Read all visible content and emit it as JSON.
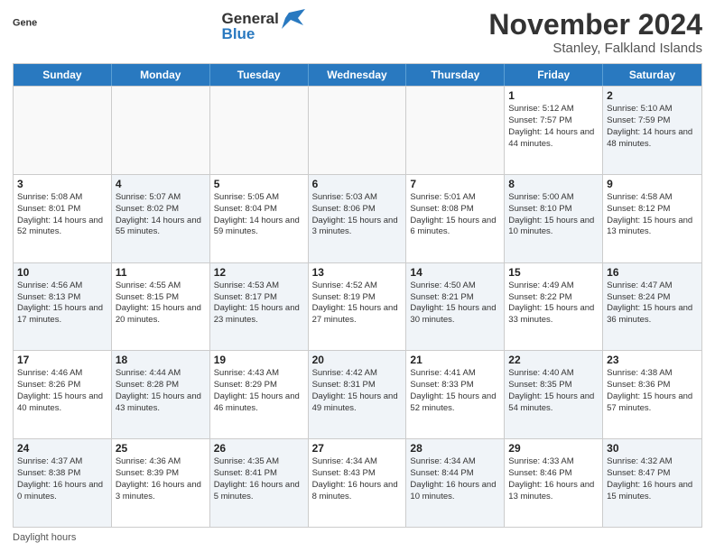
{
  "header": {
    "logo_general": "General",
    "logo_blue": "Blue",
    "month_title": "November 2024",
    "subtitle": "Stanley, Falkland Islands"
  },
  "calendar": {
    "days_of_week": [
      "Sunday",
      "Monday",
      "Tuesday",
      "Wednesday",
      "Thursday",
      "Friday",
      "Saturday"
    ],
    "rows": [
      [
        {
          "day": "",
          "info": "",
          "empty": true
        },
        {
          "day": "",
          "info": "",
          "empty": true
        },
        {
          "day": "",
          "info": "",
          "empty": true
        },
        {
          "day": "",
          "info": "",
          "empty": true
        },
        {
          "day": "",
          "info": "",
          "empty": true
        },
        {
          "day": "1",
          "info": "Sunrise: 5:12 AM\nSunset: 7:57 PM\nDaylight: 14 hours and 44 minutes.",
          "empty": false,
          "alt": false
        },
        {
          "day": "2",
          "info": "Sunrise: 5:10 AM\nSunset: 7:59 PM\nDaylight: 14 hours and 48 minutes.",
          "empty": false,
          "alt": true
        }
      ],
      [
        {
          "day": "3",
          "info": "Sunrise: 5:08 AM\nSunset: 8:01 PM\nDaylight: 14 hours and 52 minutes.",
          "empty": false,
          "alt": false
        },
        {
          "day": "4",
          "info": "Sunrise: 5:07 AM\nSunset: 8:02 PM\nDaylight: 14 hours and 55 minutes.",
          "empty": false,
          "alt": true
        },
        {
          "day": "5",
          "info": "Sunrise: 5:05 AM\nSunset: 8:04 PM\nDaylight: 14 hours and 59 minutes.",
          "empty": false,
          "alt": false
        },
        {
          "day": "6",
          "info": "Sunrise: 5:03 AM\nSunset: 8:06 PM\nDaylight: 15 hours and 3 minutes.",
          "empty": false,
          "alt": true
        },
        {
          "day": "7",
          "info": "Sunrise: 5:01 AM\nSunset: 8:08 PM\nDaylight: 15 hours and 6 minutes.",
          "empty": false,
          "alt": false
        },
        {
          "day": "8",
          "info": "Sunrise: 5:00 AM\nSunset: 8:10 PM\nDaylight: 15 hours and 10 minutes.",
          "empty": false,
          "alt": true
        },
        {
          "day": "9",
          "info": "Sunrise: 4:58 AM\nSunset: 8:12 PM\nDaylight: 15 hours and 13 minutes.",
          "empty": false,
          "alt": false
        }
      ],
      [
        {
          "day": "10",
          "info": "Sunrise: 4:56 AM\nSunset: 8:13 PM\nDaylight: 15 hours and 17 minutes.",
          "empty": false,
          "alt": true
        },
        {
          "day": "11",
          "info": "Sunrise: 4:55 AM\nSunset: 8:15 PM\nDaylight: 15 hours and 20 minutes.",
          "empty": false,
          "alt": false
        },
        {
          "day": "12",
          "info": "Sunrise: 4:53 AM\nSunset: 8:17 PM\nDaylight: 15 hours and 23 minutes.",
          "empty": false,
          "alt": true
        },
        {
          "day": "13",
          "info": "Sunrise: 4:52 AM\nSunset: 8:19 PM\nDaylight: 15 hours and 27 minutes.",
          "empty": false,
          "alt": false
        },
        {
          "day": "14",
          "info": "Sunrise: 4:50 AM\nSunset: 8:21 PM\nDaylight: 15 hours and 30 minutes.",
          "empty": false,
          "alt": true
        },
        {
          "day": "15",
          "info": "Sunrise: 4:49 AM\nSunset: 8:22 PM\nDaylight: 15 hours and 33 minutes.",
          "empty": false,
          "alt": false
        },
        {
          "day": "16",
          "info": "Sunrise: 4:47 AM\nSunset: 8:24 PM\nDaylight: 15 hours and 36 minutes.",
          "empty": false,
          "alt": true
        }
      ],
      [
        {
          "day": "17",
          "info": "Sunrise: 4:46 AM\nSunset: 8:26 PM\nDaylight: 15 hours and 40 minutes.",
          "empty": false,
          "alt": false
        },
        {
          "day": "18",
          "info": "Sunrise: 4:44 AM\nSunset: 8:28 PM\nDaylight: 15 hours and 43 minutes.",
          "empty": false,
          "alt": true
        },
        {
          "day": "19",
          "info": "Sunrise: 4:43 AM\nSunset: 8:29 PM\nDaylight: 15 hours and 46 minutes.",
          "empty": false,
          "alt": false
        },
        {
          "day": "20",
          "info": "Sunrise: 4:42 AM\nSunset: 8:31 PM\nDaylight: 15 hours and 49 minutes.",
          "empty": false,
          "alt": true
        },
        {
          "day": "21",
          "info": "Sunrise: 4:41 AM\nSunset: 8:33 PM\nDaylight: 15 hours and 52 minutes.",
          "empty": false,
          "alt": false
        },
        {
          "day": "22",
          "info": "Sunrise: 4:40 AM\nSunset: 8:35 PM\nDaylight: 15 hours and 54 minutes.",
          "empty": false,
          "alt": true
        },
        {
          "day": "23",
          "info": "Sunrise: 4:38 AM\nSunset: 8:36 PM\nDaylight: 15 hours and 57 minutes.",
          "empty": false,
          "alt": false
        }
      ],
      [
        {
          "day": "24",
          "info": "Sunrise: 4:37 AM\nSunset: 8:38 PM\nDaylight: 16 hours and 0 minutes.",
          "empty": false,
          "alt": true
        },
        {
          "day": "25",
          "info": "Sunrise: 4:36 AM\nSunset: 8:39 PM\nDaylight: 16 hours and 3 minutes.",
          "empty": false,
          "alt": false
        },
        {
          "day": "26",
          "info": "Sunrise: 4:35 AM\nSunset: 8:41 PM\nDaylight: 16 hours and 5 minutes.",
          "empty": false,
          "alt": true
        },
        {
          "day": "27",
          "info": "Sunrise: 4:34 AM\nSunset: 8:43 PM\nDaylight: 16 hours and 8 minutes.",
          "empty": false,
          "alt": false
        },
        {
          "day": "28",
          "info": "Sunrise: 4:34 AM\nSunset: 8:44 PM\nDaylight: 16 hours and 10 minutes.",
          "empty": false,
          "alt": true
        },
        {
          "day": "29",
          "info": "Sunrise: 4:33 AM\nSunset: 8:46 PM\nDaylight: 16 hours and 13 minutes.",
          "empty": false,
          "alt": false
        },
        {
          "day": "30",
          "info": "Sunrise: 4:32 AM\nSunset: 8:47 PM\nDaylight: 16 hours and 15 minutes.",
          "empty": false,
          "alt": true
        }
      ]
    ]
  },
  "footer": {
    "daylight_label": "Daylight hours"
  }
}
